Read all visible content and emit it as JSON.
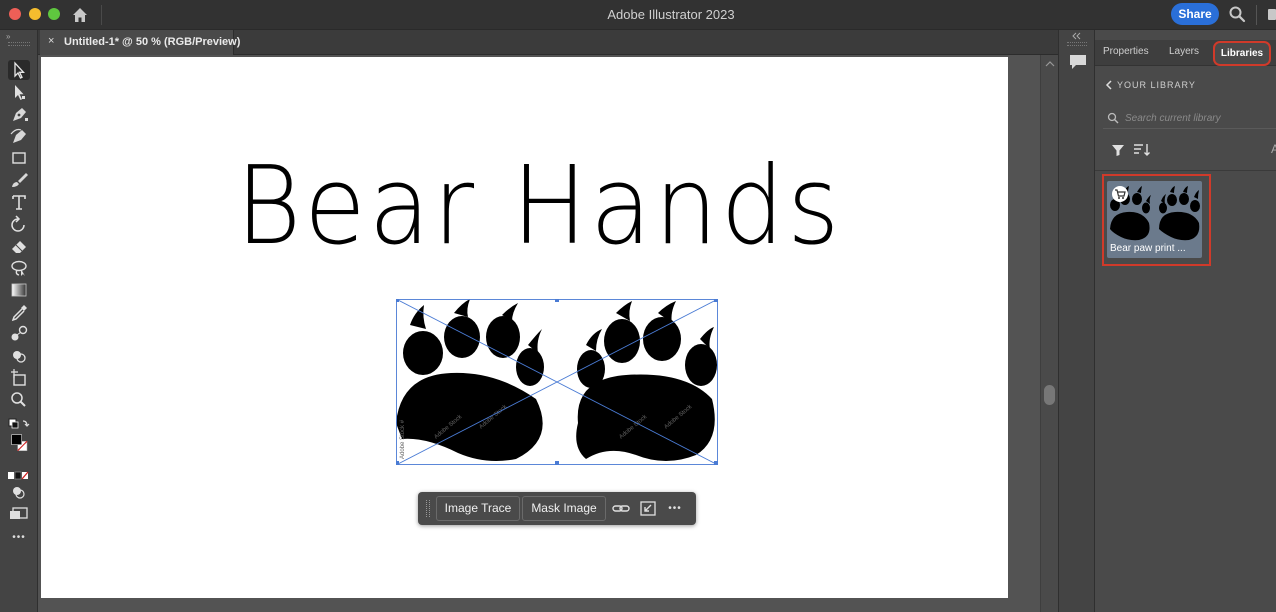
{
  "window": {
    "title": "Adobe Illustrator 2023",
    "share_label": "Share"
  },
  "document_tab": {
    "close_glyph": "×",
    "label": "Untitled-1* @ 50 % (RGB/Preview)"
  },
  "artboard": {
    "headline": "Bear Hands",
    "placed_image_watermark": "Adobe Stock"
  },
  "context_bar": {
    "image_trace_label": "Image Trace",
    "mask_image_label": "Mask Image",
    "more_glyph": "•••"
  },
  "panel": {
    "tabs": [
      {
        "label": "Properties"
      },
      {
        "label": "Layers"
      },
      {
        "label": "Libraries"
      }
    ],
    "library": {
      "back_glyph": "‹",
      "heading": "YOUR LIBRARY",
      "search_placeholder": "Search current library",
      "partial_glyph": "A",
      "item": {
        "label": "Bear paw print ..."
      }
    }
  },
  "toolbar": {
    "collapse_glyph": "»",
    "more_glyph": "•••"
  },
  "colors": {
    "accent_blue": "#2a6fd8",
    "highlight_red": "#d03a2a",
    "selection_blue": "#4a7bd4"
  }
}
